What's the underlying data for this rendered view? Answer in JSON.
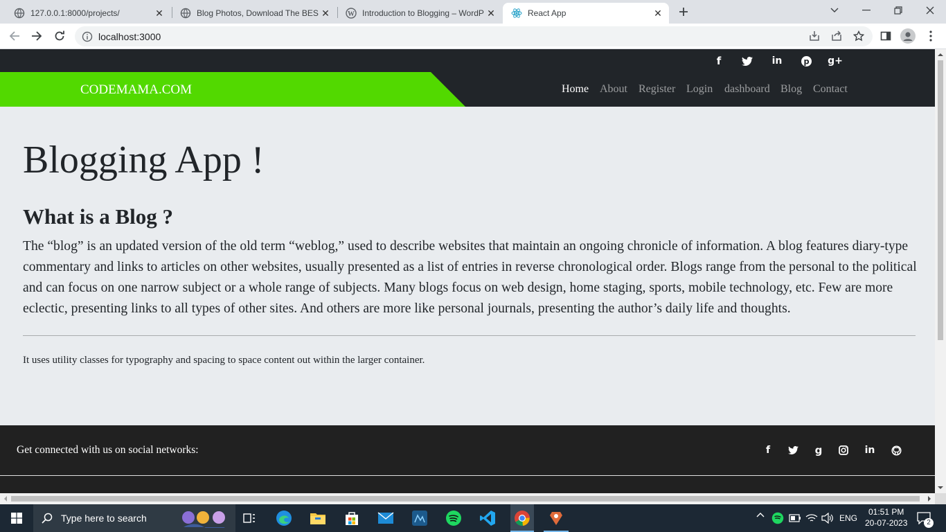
{
  "tabs": [
    {
      "title": "127.0.0.1:8000/projects/",
      "icon": "globe-icon"
    },
    {
      "title": "Blog Photos, Download The BEST",
      "icon": "globe-icon"
    },
    {
      "title": "Introduction to Blogging – WordPress",
      "icon": "wordpress-icon"
    },
    {
      "title": "React App",
      "icon": "react-icon"
    }
  ],
  "address": {
    "url": "localhost:3000"
  },
  "site": {
    "top_social": [
      "facebook-icon",
      "twitter-icon",
      "linkedin-icon",
      "pinterest-icon",
      "google-plus-icon"
    ],
    "brand": "CODEMAMA.COM",
    "brand_color": "#52d900",
    "nav": [
      "Home",
      "About",
      "Register",
      "Login",
      "dashboard",
      "Blog",
      "Contact"
    ]
  },
  "content": {
    "heading": "Blogging App !",
    "subheading": "What is a Blog ?",
    "lead": "The “blog” is an updated version of the old term “weblog,” used to describe websites that maintain an ongoing chronicle of information. A blog features diary-type commentary and links to articles on other websites, usually presented as a list of entries in reverse chronological order. Blogs range from the personal to the political and can focus on one narrow subject or a whole range of subjects. Many blogs focus on web design, home staging, sports, mobile technology, etc. Few are more eclectic, presenting links to all types of other sites. And others are more like personal journals, presenting the author’s daily life and thoughts.",
    "small": "It uses utility classes for typography and spacing to space content out within the larger container."
  },
  "footer": {
    "text": "Get connected with us on social networks:",
    "icons": [
      "facebook-icon",
      "twitter-icon",
      "google-icon",
      "instagram-icon",
      "linkedin-icon",
      "github-icon"
    ]
  },
  "taskbar": {
    "search_placeholder": "Type here to search",
    "lang": "ENG",
    "time": "01:51 PM",
    "date": "20-07-2023",
    "notifications": "2"
  }
}
